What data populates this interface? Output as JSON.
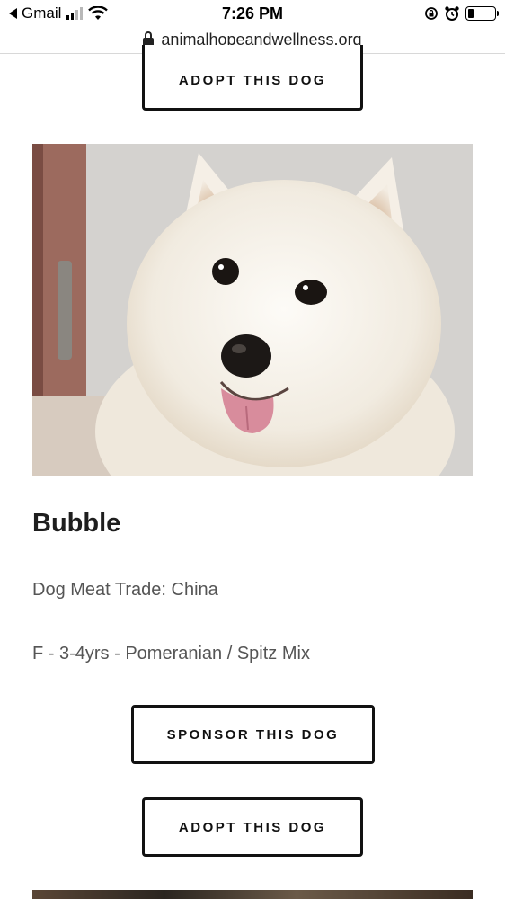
{
  "status_bar": {
    "back_app": "Gmail",
    "time": "7:26 PM"
  },
  "browser": {
    "url": "animalhopeandwellness.org"
  },
  "previous_card": {
    "adopt_label": "ADOPT THIS DOG"
  },
  "dog": {
    "name": "Bubble",
    "origin": "Dog Meat Trade: China",
    "details": "F - 3-4yrs - Pomeranian / Spitz Mix",
    "sponsor_label": "SPONSOR THIS DOG",
    "adopt_label": "ADOPT THIS DOG"
  },
  "icons": {
    "back": "back-arrow-icon",
    "signal": "cellular-signal-icon",
    "wifi": "wifi-icon",
    "rotation_lock": "rotation-lock-icon",
    "alarm": "alarm-icon",
    "battery": "battery-icon",
    "lock": "lock-icon"
  },
  "battery_level": 0.2
}
